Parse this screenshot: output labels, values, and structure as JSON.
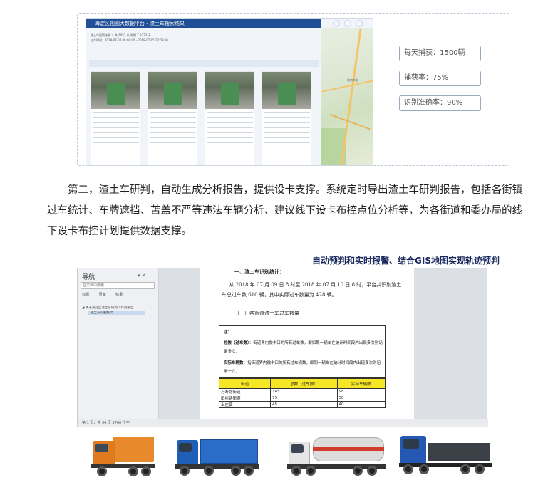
{
  "screen": {
    "title": "海淀区视图大数据平台 - 渣土车搜索结果",
    "info_line1": "渣土车报警结果 > 共 1052 条  周期 7.8333 天",
    "info_line2": "过车时间：2018-07-04 09:00:00 - 2018-07-05 12:09:50",
    "map_label": "北京大学"
  },
  "stats": {
    "daily_capture": "每天捕获：1500辆",
    "capture_rate": "捕获率：75%",
    "recognition_accuracy": "识别准确率：90%"
  },
  "paragraph": "第二，渣土车研判，自动生成分析报告，提供设卡支撑。系统定时导出渣土车研判报告，包括各街镇过车统计、车牌遮挡、苫盖不严等违法车辆分析、建议线下设卡布控点位分析等，为各街道和委办局的线下设卡布控计划提供数据支撑。",
  "bottom": {
    "heading_part1": "自动预判和实时报警、结合",
    "heading_part2": "GIS地图",
    "heading_part3": "实现轨迹预判",
    "nav": {
      "title": "导航",
      "search_placeholder": "在文档中搜索",
      "tabs": [
        "标题",
        "页面",
        "结果"
      ],
      "item_parent": "◢ 关于海淀区渣土车研判工作的报告",
      "item_child": "渣土车识别统计"
    },
    "doc": {
      "section_heading": "一、渣土车识别统计：",
      "intro": "从 2018 年 07 月 09 日 8 时至 2018 年 07 月 10 日 8 时，平台共识别渣土车总过车数 610 辆，其中实际过车数量为 428 辆。",
      "sub_heading": "（一）各街道渣土车过车数量",
      "note_label": "注：",
      "note_total_label": "总数（过车数）",
      "note_total_text": "：街道界内微卡口的所有过车数，即如果一辆车在统计时间段内出现多次则记录多次；",
      "note_actual_label": "实际车辆数",
      "note_actual_text": "：指街道界内微卡口的所有过车辆数，即同一辆车在统计时间段内出现多次则记录一次；",
      "table_headers": [
        "街道",
        "总数（过车数）",
        "实际车辆数"
      ],
      "table_rows": [
        [
          "万寿路街道",
          "145",
          "98"
        ],
        [
          "田村路街道",
          "75",
          "58"
        ],
        [
          "上庄镇",
          "45",
          "40"
        ]
      ]
    },
    "statusbar": "第 1 页，共 34 页    3766 个字"
  }
}
